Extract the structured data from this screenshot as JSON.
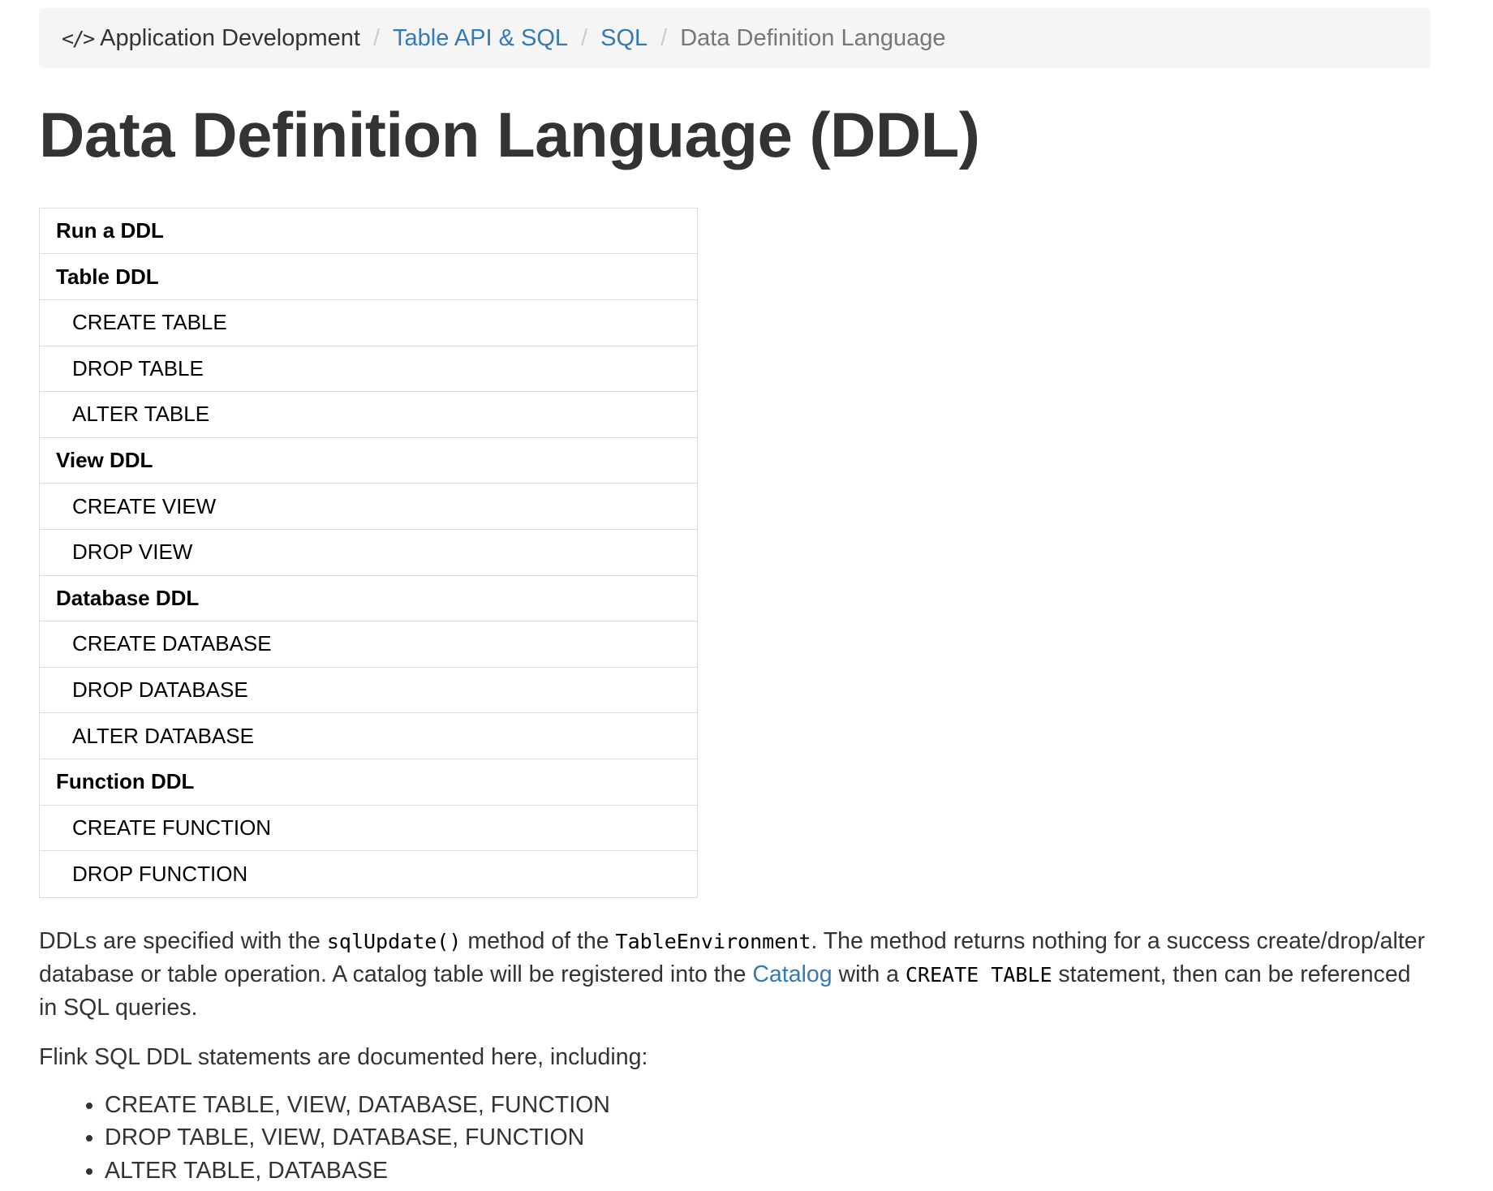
{
  "breadcrumb": {
    "icon": "code-icon",
    "icon_glyph": "</>",
    "root": "Application Development",
    "items": [
      "Table API & SQL",
      "SQL"
    ],
    "current": "Data Definition Language",
    "separator": "/"
  },
  "page_title": "Data Definition Language (DDL)",
  "toc": [
    {
      "label": "Run a DDL",
      "level": "header"
    },
    {
      "label": "Table DDL",
      "level": "header"
    },
    {
      "label": "CREATE TABLE",
      "level": "sub"
    },
    {
      "label": "DROP TABLE",
      "level": "sub"
    },
    {
      "label": "ALTER TABLE",
      "level": "sub"
    },
    {
      "label": "View DDL",
      "level": "header"
    },
    {
      "label": "CREATE VIEW",
      "level": "sub"
    },
    {
      "label": "DROP VIEW",
      "level": "sub"
    },
    {
      "label": "Database DDL",
      "level": "header"
    },
    {
      "label": "CREATE DATABASE",
      "level": "sub"
    },
    {
      "label": "DROP DATABASE",
      "level": "sub"
    },
    {
      "label": "ALTER DATABASE",
      "level": "sub"
    },
    {
      "label": "Function DDL",
      "level": "header"
    },
    {
      "label": "CREATE FUNCTION",
      "level": "sub"
    },
    {
      "label": "DROP FUNCTION",
      "level": "sub"
    }
  ],
  "intro": {
    "t1": "DDLs are specified with the ",
    "code1": "sqlUpdate()",
    "t2": " method of the ",
    "code2": "TableEnvironment",
    "t3": ". The method returns nothing for a success create/drop/alter database or table operation. A catalog table will be registered into the ",
    "link": "Catalog",
    "t4": " with a ",
    "code3": "CREATE TABLE",
    "t5": " statement, then can be referenced in SQL queries."
  },
  "statements_intro": "Flink SQL DDL statements are documented here, including:",
  "statements": [
    "CREATE TABLE, VIEW, DATABASE, FUNCTION",
    "DROP TABLE, VIEW, DATABASE, FUNCTION",
    "ALTER TABLE, DATABASE"
  ]
}
